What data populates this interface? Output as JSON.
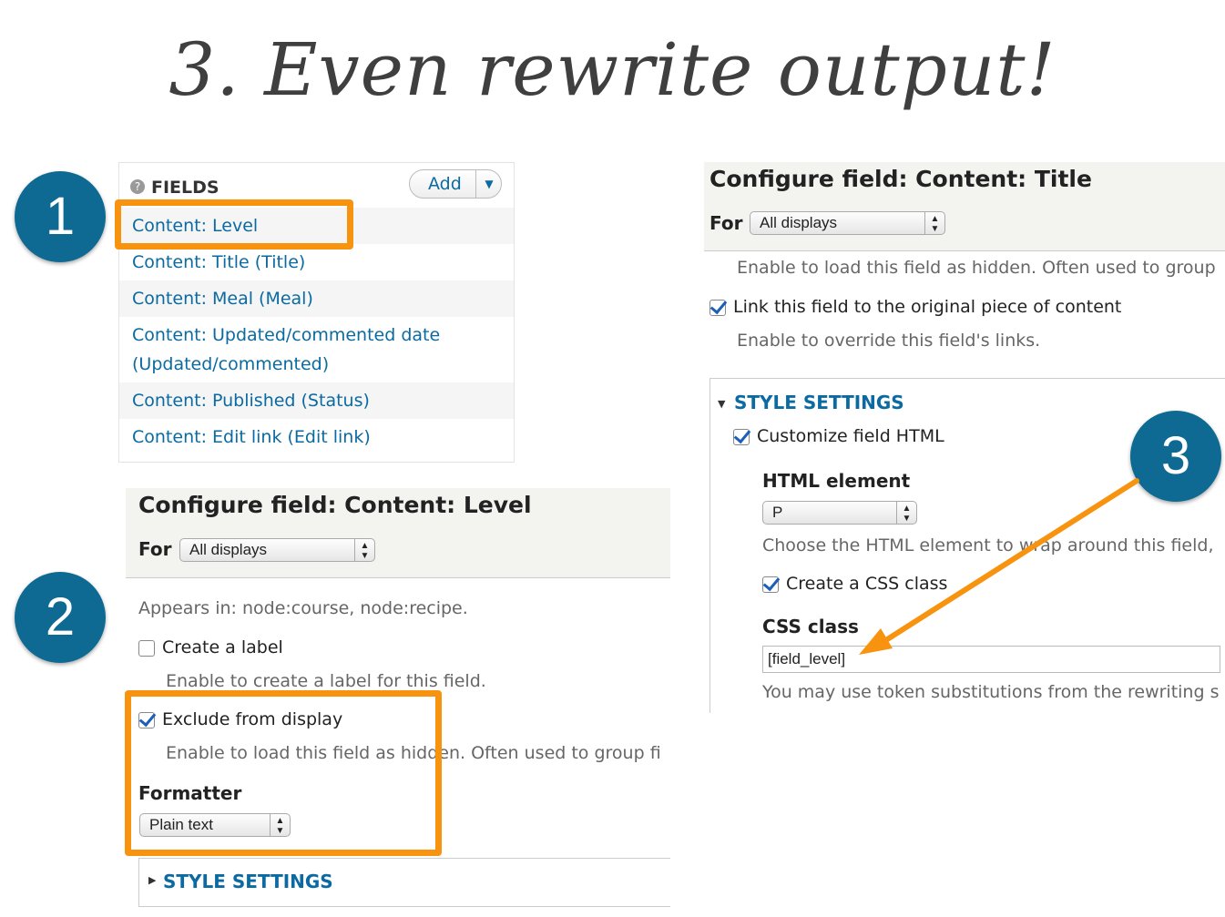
{
  "title": "3. Even rewrite output!",
  "badges": [
    "1",
    "2",
    "3"
  ],
  "fields_panel": {
    "heading": "FIELDS",
    "add_label": "Add",
    "items": [
      "Content: Level",
      "Content: Title (Title)",
      "Content: Meal (Meal)",
      "Content: Updated/commented date",
      "(Updated/commented)",
      "Content: Published (Status)",
      "Content: Edit link (Edit link)"
    ]
  },
  "level_panel": {
    "heading": "Configure field: Content: Level",
    "for_label": "For",
    "for_value": "All displays",
    "appears_in": "Appears in: node:course, node:recipe.",
    "create_label": "Create a label",
    "create_label_help": "Enable to create a label for this field.",
    "exclude_label": "Exclude from display",
    "exclude_help": "Enable to load this field as hidden. Often used to group fi",
    "formatter_label": "Formatter",
    "formatter_value": "Plain text",
    "style_settings": "STYLE SETTINGS"
  },
  "title_panel": {
    "heading": "Configure field: Content: Title",
    "for_label": "For",
    "for_value": "All displays",
    "hidden_help": "Enable to load this field as hidden. Often used to group",
    "link_label": "Link this field to the original piece of content",
    "link_help": "Enable to override this field's links.",
    "style_settings": "STYLE SETTINGS",
    "customize_label": "Customize field HTML",
    "html_element_label": "HTML element",
    "html_element_value": "P",
    "html_element_help": "Choose the HTML element to wrap around this field,",
    "css_class_checkbox": "Create a CSS class",
    "css_class_label": "CSS class",
    "css_class_value": "[field_level]",
    "css_class_help": "You may use token substitutions from the rewriting s"
  },
  "colors": {
    "badge": "#0e6a93",
    "highlight": "#f7930e",
    "link": "#0a6aa1"
  }
}
